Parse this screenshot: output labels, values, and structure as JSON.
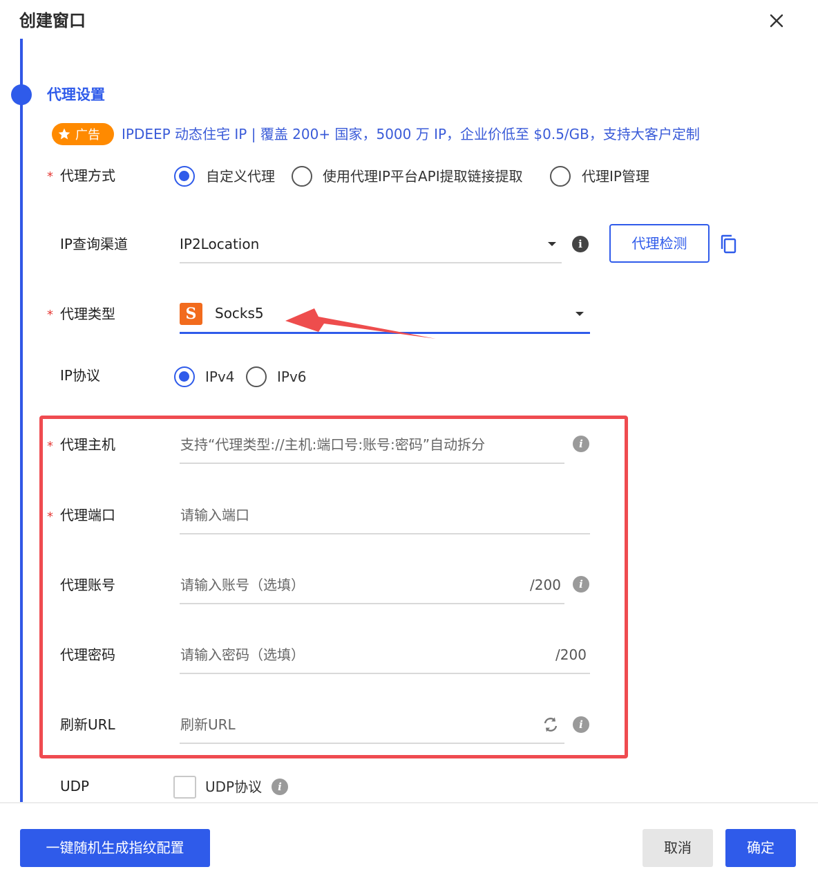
{
  "dialog": {
    "title": "创建窗口"
  },
  "section": {
    "title": "代理设置"
  },
  "ad": {
    "badge": "广告",
    "text": "IPDEEP 动态住宅 IP | 覆盖 200+ 国家，5000 万 IP，企业价低至 $0.5/GB，支持大客户定制"
  },
  "proxy_method": {
    "label": "代理方式",
    "options": [
      "自定义代理",
      "使用代理IP平台API提取链接提取",
      "代理IP管理"
    ],
    "selected": "自定义代理"
  },
  "ip_channel": {
    "label": "IP查询渠道",
    "value": "IP2Location",
    "check_button": "代理检测"
  },
  "proxy_type": {
    "label": "代理类型",
    "icon_letter": "S",
    "value": "Socks5"
  },
  "ip_protocol": {
    "label": "IP协议",
    "options": [
      "IPv4",
      "IPv6"
    ],
    "selected": "IPv4"
  },
  "proxy_host": {
    "label": "代理主机",
    "placeholder": "支持“代理类型://主机:端口号:账号:密码”自动拆分"
  },
  "proxy_port": {
    "label": "代理端口",
    "placeholder": "请输入端口"
  },
  "proxy_account": {
    "label": "代理账号",
    "placeholder": "请输入账号（选填）",
    "counter": "/200"
  },
  "proxy_password": {
    "label": "代理密码",
    "placeholder": "请输入密码（选填）",
    "counter": "/200"
  },
  "refresh_url": {
    "label": "刷新URL",
    "placeholder": "刷新URL"
  },
  "udp": {
    "label": "UDP",
    "checkbox_label": "UDP协议"
  },
  "footer": {
    "random_button": "一键随机生成指纹配置",
    "cancel_button": "取消",
    "confirm_button": "确定"
  },
  "colors": {
    "accent": "#2f5bea",
    "required": "#e53935",
    "ad_badge": "#ff8a00",
    "highlight_box": "#ef4b50",
    "socks_icon": "#f26b1d"
  },
  "icons": {
    "close": "close-icon",
    "star": "star-icon",
    "info": "info-icon",
    "copy": "copy-icon",
    "refresh": "refresh-icon",
    "caret": "chevron-down-icon",
    "annotation_arrow": "annotation-arrow"
  }
}
